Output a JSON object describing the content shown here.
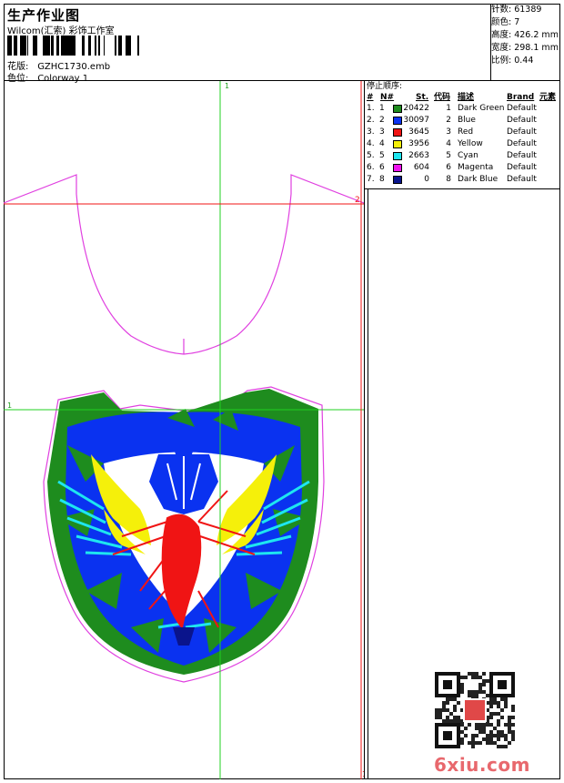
{
  "header": {
    "title": "生产作业图",
    "subtitle": "Wilcom(汇索) 彩饰工作室",
    "design_label": "花版:",
    "design_value": "GZHC1730.emb",
    "colorway_label": "色位:",
    "colorway_value": "Colorway 1"
  },
  "stats": {
    "stitches": "针数: 61389",
    "colors": "颜色: 7",
    "height": "高度: 426.2 mm",
    "width": "宽度: 298.1 mm",
    "scale": "比例: 0.44"
  },
  "stop_sequence": {
    "heading": "停止顺序:",
    "columns": {
      "num": "#",
      "n": "N#",
      "st": "St.",
      "code": "代码",
      "desc": "描述",
      "brand": "Brand",
      "elem": "元素"
    },
    "rows": [
      {
        "idx": "1.",
        "n": "1",
        "color": "#1e8c1e",
        "st": "20422",
        "code": "1",
        "desc": "Dark Green",
        "brand": "Default"
      },
      {
        "idx": "2.",
        "n": "2",
        "color": "#0a32f0",
        "st": "30097",
        "code": "2",
        "desc": "Blue",
        "brand": "Default"
      },
      {
        "idx": "3.",
        "n": "3",
        "color": "#f01414",
        "st": "3645",
        "code": "3",
        "desc": "Red",
        "brand": "Default"
      },
      {
        "idx": "4.",
        "n": "4",
        "color": "#f5f00a",
        "st": "3956",
        "code": "4",
        "desc": "Yellow",
        "brand": "Default"
      },
      {
        "idx": "5.",
        "n": "5",
        "color": "#1ee6f0",
        "st": "2663",
        "code": "5",
        "desc": "Cyan",
        "brand": "Default"
      },
      {
        "idx": "6.",
        "n": "6",
        "color": "#f014f0",
        "st": "604",
        "code": "6",
        "desc": "Magenta",
        "brand": "Default"
      },
      {
        "idx": "7.",
        "n": "8",
        "color": "#0a148c",
        "st": "0",
        "code": "8",
        "desc": "Dark Blue",
        "brand": "Default"
      }
    ]
  },
  "markers": {
    "top_mark": "1",
    "left_mark": "1",
    "red_mark": "2",
    "bottom_mark": "1"
  },
  "watermark": "6xiu.com"
}
